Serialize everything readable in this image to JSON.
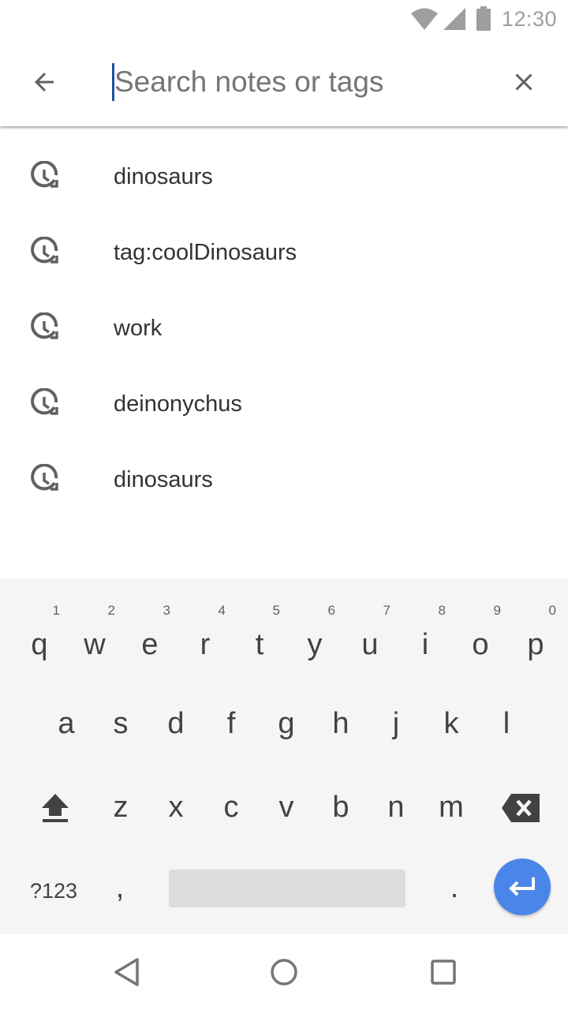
{
  "status_bar": {
    "time": "12:30",
    "icons": [
      "wifi-icon",
      "cell-signal-icon",
      "battery-icon"
    ],
    "color": "#9e9e9e"
  },
  "toolbar": {
    "back_icon": "arrow-back-icon",
    "search_placeholder": "Search notes or tags",
    "search_value": "",
    "clear_icon": "close-icon"
  },
  "suggestions": [
    {
      "icon": "history-icon",
      "text": "dinosaurs"
    },
    {
      "icon": "history-icon",
      "text": "tag:coolDinosaurs"
    },
    {
      "icon": "history-icon",
      "text": "work"
    },
    {
      "icon": "history-icon",
      "text": "deinonychus"
    },
    {
      "icon": "history-icon",
      "text": "dinosaurs"
    }
  ],
  "keyboard": {
    "row1": [
      {
        "key": "q",
        "hint": "1"
      },
      {
        "key": "w",
        "hint": "2"
      },
      {
        "key": "e",
        "hint": "3"
      },
      {
        "key": "r",
        "hint": "4"
      },
      {
        "key": "t",
        "hint": "5"
      },
      {
        "key": "y",
        "hint": "6"
      },
      {
        "key": "u",
        "hint": "7"
      },
      {
        "key": "i",
        "hint": "8"
      },
      {
        "key": "o",
        "hint": "9"
      },
      {
        "key": "p",
        "hint": "0"
      }
    ],
    "row2": [
      "a",
      "s",
      "d",
      "f",
      "g",
      "h",
      "j",
      "k",
      "l"
    ],
    "row3": [
      "z",
      "x",
      "c",
      "v",
      "b",
      "n",
      "m"
    ],
    "shift_icon": "shift-icon",
    "backspace_icon": "backspace-icon",
    "symbols_label": "?123",
    "comma": ",",
    "period": ".",
    "enter_icon": "enter-icon",
    "enter_color": "#4a86ea"
  },
  "navbar": {
    "icons": [
      "nav-back-icon",
      "nav-home-icon",
      "nav-recents-icon"
    ]
  }
}
